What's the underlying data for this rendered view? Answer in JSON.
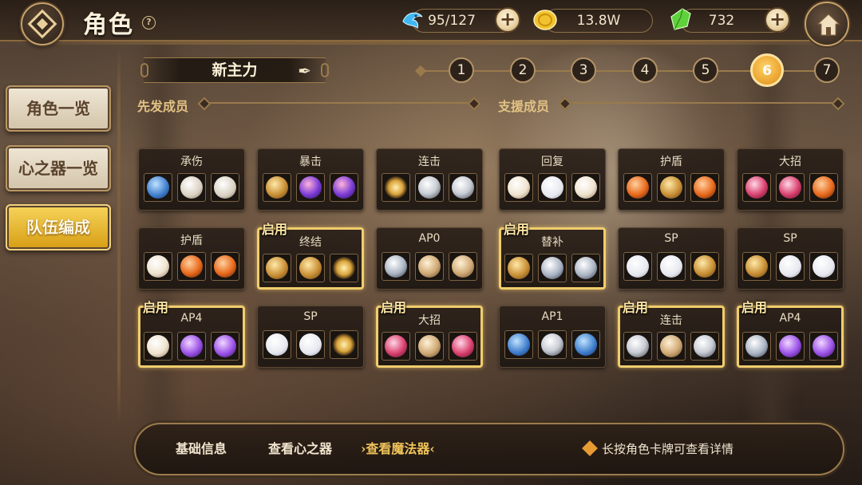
{
  "header": {
    "title": "角色",
    "help": "?",
    "resources": [
      {
        "name": "stamina",
        "icon": "blue-fish-icon",
        "value": "95/127",
        "color": "#3fb7f2"
      },
      {
        "name": "gold",
        "icon": "gold-coin-icon",
        "value": "13.8W",
        "color": "#f2c22e"
      },
      {
        "name": "gem",
        "icon": "green-crystal-icon",
        "value": "732",
        "color": "#5fd13c"
      }
    ],
    "plus": "+"
  },
  "sidebar": {
    "items": [
      {
        "label": "角色一览",
        "active": false
      },
      {
        "label": "心之器一览",
        "active": false
      },
      {
        "label": "队伍编成",
        "active": true
      }
    ]
  },
  "team": {
    "name": "新主力",
    "edit_icon": "quill-icon"
  },
  "pager": {
    "pages": [
      "1",
      "2",
      "3",
      "4",
      "5",
      "6",
      "7"
    ],
    "active": "6"
  },
  "sections": {
    "starters": "先发成员",
    "support": "支援成员"
  },
  "enabled_label": "启用",
  "cards": [
    {
      "label": "承伤",
      "enabled": false,
      "items": [
        "staff-blue",
        "urn-white",
        "urn-white"
      ]
    },
    {
      "label": "暴击",
      "enabled": false,
      "items": [
        "shield-gold",
        "orb-purple",
        "orb-purple"
      ]
    },
    {
      "label": "连击",
      "enabled": false,
      "items": [
        "sun-gold",
        "axe-silver",
        "axe-silver"
      ]
    },
    {
      "label": "回复",
      "enabled": false,
      "items": [
        "watch-white",
        "cloth-white",
        "watch-white"
      ]
    },
    {
      "label": "护盾",
      "enabled": false,
      "items": [
        "lance-orange",
        "shield-gold",
        "lance-orange"
      ]
    },
    {
      "label": "大招",
      "enabled": false,
      "items": [
        "gem-pink",
        "gem-pink",
        "lance-orange"
      ]
    },
    {
      "label": "护盾",
      "enabled": false,
      "items": [
        "watch-white",
        "lance-orange",
        "lance-orange"
      ]
    },
    {
      "label": "终结",
      "enabled": true,
      "items": [
        "shield-gold",
        "shield-gold",
        "sun-gold"
      ]
    },
    {
      "label": "AP0",
      "enabled": false,
      "items": [
        "staff-silver",
        "bag-tan",
        "bag-tan"
      ]
    },
    {
      "label": "替补",
      "enabled": true,
      "items": [
        "shield-gold",
        "staff-silver",
        "staff-silver"
      ]
    },
    {
      "label": "SP",
      "enabled": false,
      "items": [
        "cloth-white",
        "cloth-white",
        "shield-gold"
      ]
    },
    {
      "label": "SP",
      "enabled": false,
      "items": [
        "shield-gold",
        "cloth-white",
        "cloth-white"
      ]
    },
    {
      "label": "AP4",
      "enabled": true,
      "items": [
        "watch-white",
        "ring-purple",
        "ring-purple"
      ]
    },
    {
      "label": "SP",
      "enabled": false,
      "items": [
        "cloth-white",
        "cloth-white",
        "sun-gold"
      ]
    },
    {
      "label": "大招",
      "enabled": true,
      "items": [
        "gem-pink",
        "bag-tan",
        "gem-pink"
      ]
    },
    {
      "label": "AP1",
      "enabled": false,
      "items": [
        "staff-blue",
        "axe-silver",
        "staff-blue"
      ]
    },
    {
      "label": "连击",
      "enabled": true,
      "items": [
        "axe-silver",
        "bag-tan",
        "axe-silver"
      ]
    },
    {
      "label": "AP4",
      "enabled": true,
      "items": [
        "staff-silver",
        "ring-purple",
        "ring-purple"
      ]
    }
  ],
  "bottom": {
    "tabs": [
      {
        "label": "基础信息",
        "active": false
      },
      {
        "label": "查看心之器",
        "active": false
      },
      {
        "label": "›查看魔法器‹",
        "active": true
      }
    ],
    "hint": "长按角色卡牌可查看详情"
  }
}
